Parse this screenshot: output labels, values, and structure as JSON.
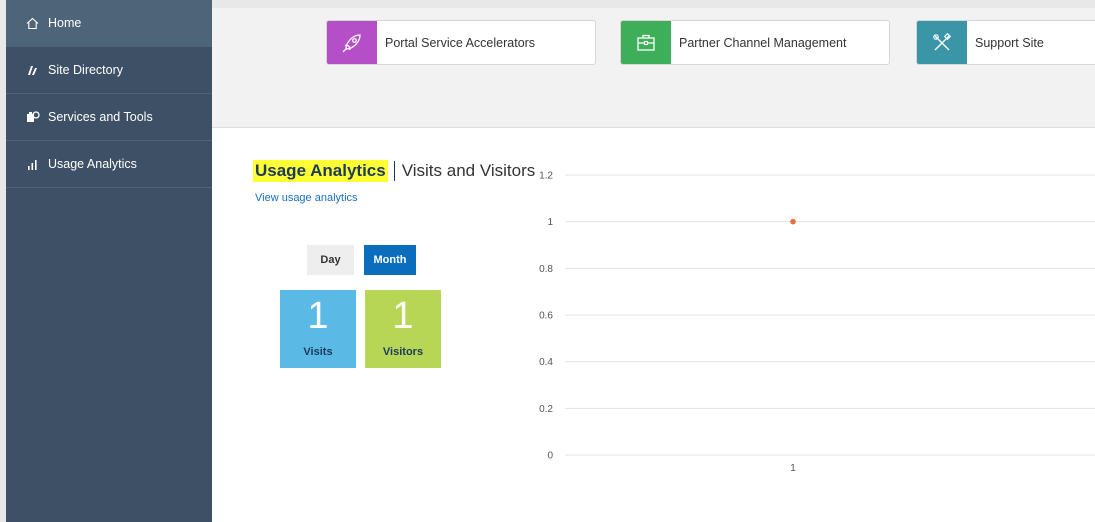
{
  "sidebar": {
    "items": [
      {
        "label": "Home",
        "icon": "home-icon",
        "active": true
      },
      {
        "label": "Site Directory",
        "icon": "site-directory-icon",
        "active": false
      },
      {
        "label": "Services and Tools",
        "icon": "services-tools-icon",
        "active": false
      },
      {
        "label": "Usage Analytics",
        "icon": "bar-chart-icon",
        "active": false
      }
    ]
  },
  "tiles": [
    {
      "label": "Portal Service Accelerators",
      "icon": "rocket-icon",
      "color": "#b44fc7"
    },
    {
      "label": "Partner Channel Management",
      "icon": "briefcase-icon",
      "color": "#3fae5a"
    },
    {
      "label": "Support Site",
      "icon": "tools-icon",
      "color": "#3a95a6"
    }
  ],
  "usage": {
    "title": "Usage Analytics",
    "subtitle": "Visits and Visitors",
    "link": "View usage analytics",
    "toggle": {
      "day": "Day",
      "month": "Month",
      "selected": "Month"
    },
    "visits": {
      "value": "1",
      "label": "Visits"
    },
    "visitors": {
      "value": "1",
      "label": "Visitors"
    }
  },
  "chart_data": {
    "type": "scatter",
    "title": "",
    "xlabel": "",
    "ylabel": "",
    "x": [
      1
    ],
    "y": [
      1
    ],
    "yticks": [
      "0",
      "0.2",
      "0.4",
      "0.6",
      "0.8",
      "1",
      "1.2"
    ],
    "xticks": [
      "1"
    ],
    "ylim": [
      0,
      1.2
    ],
    "grid": true,
    "point_color": "#e8703a"
  }
}
